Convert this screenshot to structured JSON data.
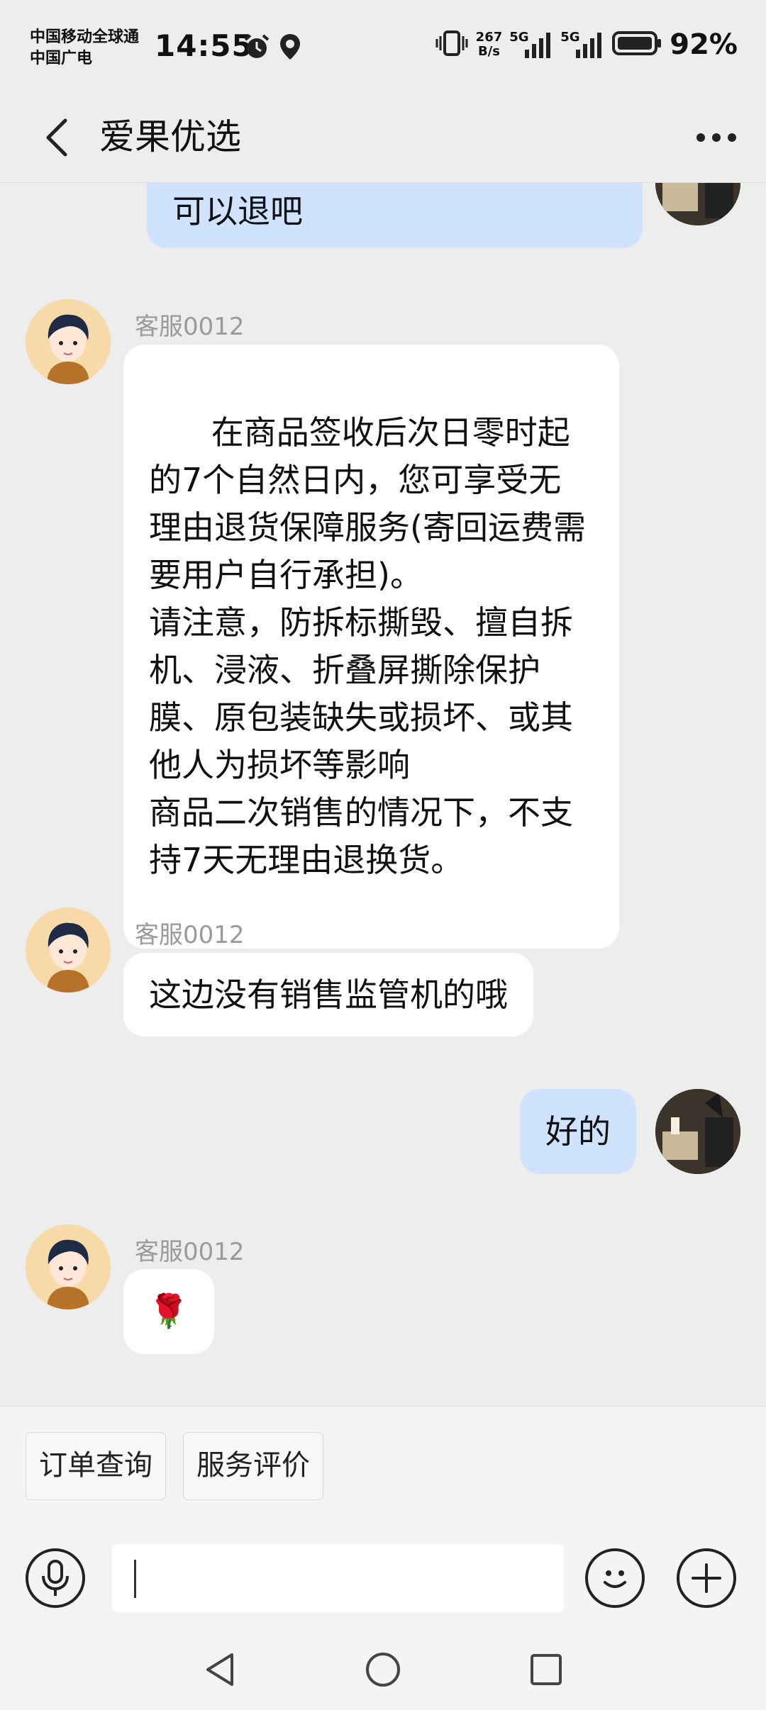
{
  "status_bar": {
    "carrier_line1": "中国移动全球通",
    "carrier_line2": "中国广电",
    "time": "14:55",
    "net_speed_value": "267",
    "net_speed_unit": "B/s",
    "sim1_type": "5G",
    "sim2_type": "5G",
    "battery": "92%",
    "icons": [
      "alarm-icon",
      "location-icon",
      "vibrate-icon",
      "signal-icon",
      "battery-icon"
    ]
  },
  "header": {
    "title": "爱果优选",
    "back_icon": "chevron-left-icon",
    "more_icon": "more-dots-icon"
  },
  "messages": [
    {
      "from": "me",
      "text": "可以退吧"
    },
    {
      "from": "agent",
      "sender": "客服0012",
      "text": "在商品签收后次日零时起的7个自然日内，您可享受无理由退货保障服务(寄回运费需要用户自行承担)。\n请注意，防拆标撕毁、擅自拆机、浸液、折叠屏撕除保护膜、原包装缺失或损坏、或其他人为损坏等影响\n商品二次销售的情况下，不支持7天无理由退换货。"
    },
    {
      "from": "agent",
      "sender": "客服0012",
      "text": "这边没有销售监管机的哦"
    },
    {
      "from": "me",
      "text": "好的"
    },
    {
      "from": "agent",
      "sender": "客服0012",
      "text": "🌹"
    }
  ],
  "quick_actions": {
    "order_query": "订单查询",
    "service_review": "服务评价"
  },
  "input": {
    "value": "",
    "placeholder": "",
    "voice_icon": "microphone-icon",
    "emoji_icon": "emoji-icon",
    "plus_icon": "plus-icon"
  },
  "nav": {
    "back": "back-triangle-icon",
    "home": "home-circle-icon",
    "recents": "recents-square-icon"
  },
  "colors": {
    "my_bubble": "#cfe3ff",
    "their_bubble": "#ffffff",
    "background": "#ededed"
  }
}
